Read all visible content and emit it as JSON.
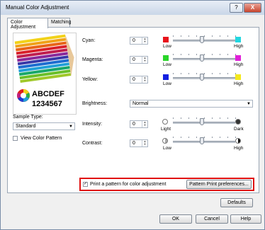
{
  "window": {
    "title": "Manual Color Adjustment",
    "help_glyph": "?",
    "close_glyph": "X"
  },
  "tabs": [
    {
      "label": "Color Adjustment"
    },
    {
      "label": "Matching"
    }
  ],
  "preview": {
    "text_line1": "ABCDEF",
    "text_line2": "1234567"
  },
  "sample_type": {
    "label": "Sample Type:",
    "value": "Standard"
  },
  "view_color_pattern": {
    "label": "View Color Pattern",
    "checked": false
  },
  "colors": {
    "cyan": {
      "label": "Cyan:",
      "value": "0",
      "low": "Low",
      "high": "High",
      "low_color": "#e8141c",
      "high_color": "#22d7e0"
    },
    "magenta": {
      "label": "Magenta:",
      "value": "0",
      "low": "Low",
      "high": "High",
      "low_color": "#2ad52a",
      "high_color": "#e020d8"
    },
    "yellow": {
      "label": "Yellow:",
      "value": "0",
      "low": "Low",
      "high": "High",
      "low_color": "#1420e0",
      "high_color": "#f4e81c"
    }
  },
  "brightness": {
    "label": "Brightness:",
    "value": "Normal"
  },
  "intensity": {
    "label": "Intensity:",
    "value": "0",
    "low": "Light",
    "high": "Dark"
  },
  "contrast": {
    "label": "Contrast:",
    "value": "0",
    "low": "Low",
    "high": "High"
  },
  "print_pattern": {
    "label": "Print a pattern for color adjustment",
    "checked": true,
    "button": "Pattern Print preferences..."
  },
  "buttons": {
    "defaults": "Defaults",
    "ok": "OK",
    "cancel": "Cancel",
    "help": "Help"
  }
}
